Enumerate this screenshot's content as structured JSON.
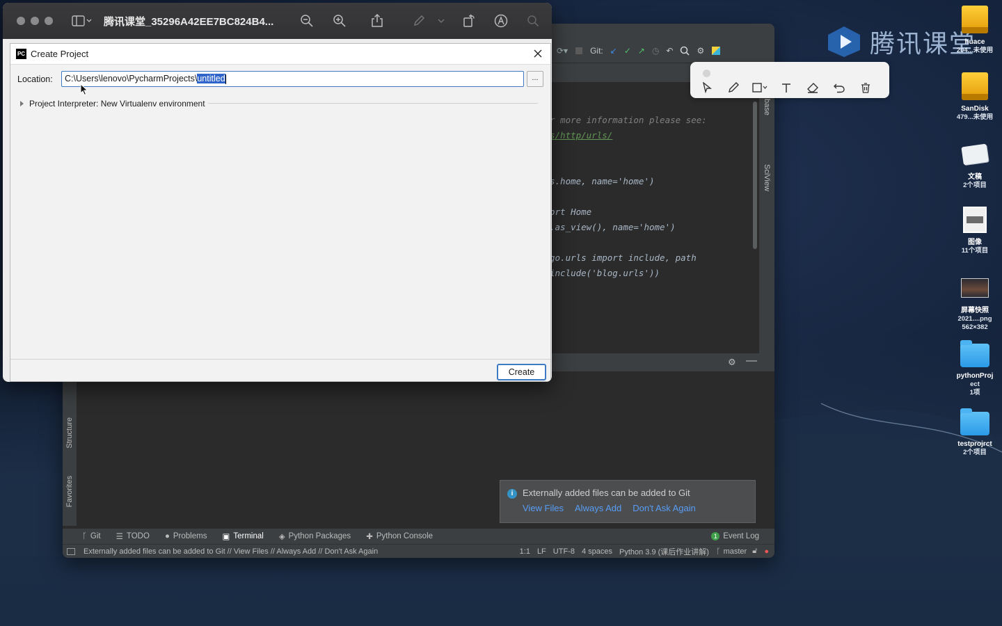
{
  "watermark": {
    "text": "腾讯课堂"
  },
  "desktop": {
    "icons": [
      {
        "label": "huace",
        "sub": "204...未使用",
        "icon": "external-drive-icon"
      },
      {
        "label": "SanDisk",
        "sub": "479...未使用",
        "icon": "external-drive-icon"
      },
      {
        "label": "文稿",
        "sub": "2个项目",
        "icon": "documents-icon"
      },
      {
        "label": "图像",
        "sub": "11个项目",
        "icon": "images-icon"
      },
      {
        "label": "屏幕快照",
        "sub": "2021....png",
        "sub2": "562×382",
        "icon": "screenshot-thumbnail-icon"
      },
      {
        "label": "pythonProj",
        "sub": "ect",
        "sub2": "1项",
        "icon": "folder-icon"
      },
      {
        "label": "testprojrct",
        "sub": "2个项目",
        "icon": "folder-icon"
      }
    ]
  },
  "preview": {
    "title": "腾讯课堂_35296A42EE7BC824B4...",
    "icons": [
      "sidebar-icon",
      "zoom-out-icon",
      "zoom-in-icon",
      "share-icon",
      "markup-icon",
      "rotate-icon",
      "annotate-icon",
      "search-icon"
    ]
  },
  "dialog": {
    "title": "Create Project",
    "location_label": "Location:",
    "location_prefix": "C:\\Users\\lenovo\\PycharmProjects\\",
    "location_selected": "untitled",
    "browse_label": "...",
    "interpreter_label": "Project Interpreter: New Virtualenv environment",
    "create_label": "Create"
  },
  "ide": {
    "git_label": "Git:",
    "code_lines": [
      {
        "text": "r more information please see:",
        "style": "gray"
      },
      {
        "text": "s/http/urls/",
        "style": "link"
      },
      {
        "text": "",
        "style": ""
      },
      {
        "text": "",
        "style": ""
      },
      {
        "text": "s.home, name='home')",
        "style": "code"
      },
      {
        "text": "",
        "style": ""
      },
      {
        "text": "ort Home",
        "style": "code"
      },
      {
        "text": ".as_view(), name='home')",
        "style": "code"
      },
      {
        "text": "",
        "style": ""
      },
      {
        "text": "go.urls import include, path",
        "style": "code"
      },
      {
        "text": " include('blog.urls'))",
        "style": "code"
      }
    ],
    "right_strip": [
      "base",
      "SciView"
    ],
    "left_strip": [
      "Structure",
      "Favorites"
    ],
    "bottom_tools": [
      {
        "label": "Git",
        "icon": "git-branch-icon"
      },
      {
        "label": "TODO",
        "icon": "list-icon"
      },
      {
        "label": "Problems",
        "icon": "info-icon"
      },
      {
        "label": "Terminal",
        "icon": "terminal-icon"
      },
      {
        "label": "Python Packages",
        "icon": "package-icon"
      },
      {
        "label": "Python Console",
        "icon": "python-icon"
      }
    ],
    "event_log": "Event Log",
    "event_log_count": "1",
    "status": {
      "message": "Externally added files can be added to Git // View Files // Always Add // Don't Ask Again",
      "position": "1:1",
      "line_sep": "LF",
      "encoding": "UTF-8",
      "indent": "4 spaces",
      "interpreter": "Python 3.9 (课后作业讲解)",
      "branch": "master"
    },
    "notification": {
      "title": "Externally added files can be added to Git",
      "links": [
        "View Files",
        "Always Add",
        "Don't Ask Again"
      ]
    }
  },
  "annotation_toolbar": {
    "tools": [
      "select-arrow-icon",
      "pen-icon",
      "shape-rectangle-icon",
      "text-icon",
      "eraser-icon",
      "undo-icon",
      "trash-icon"
    ]
  }
}
